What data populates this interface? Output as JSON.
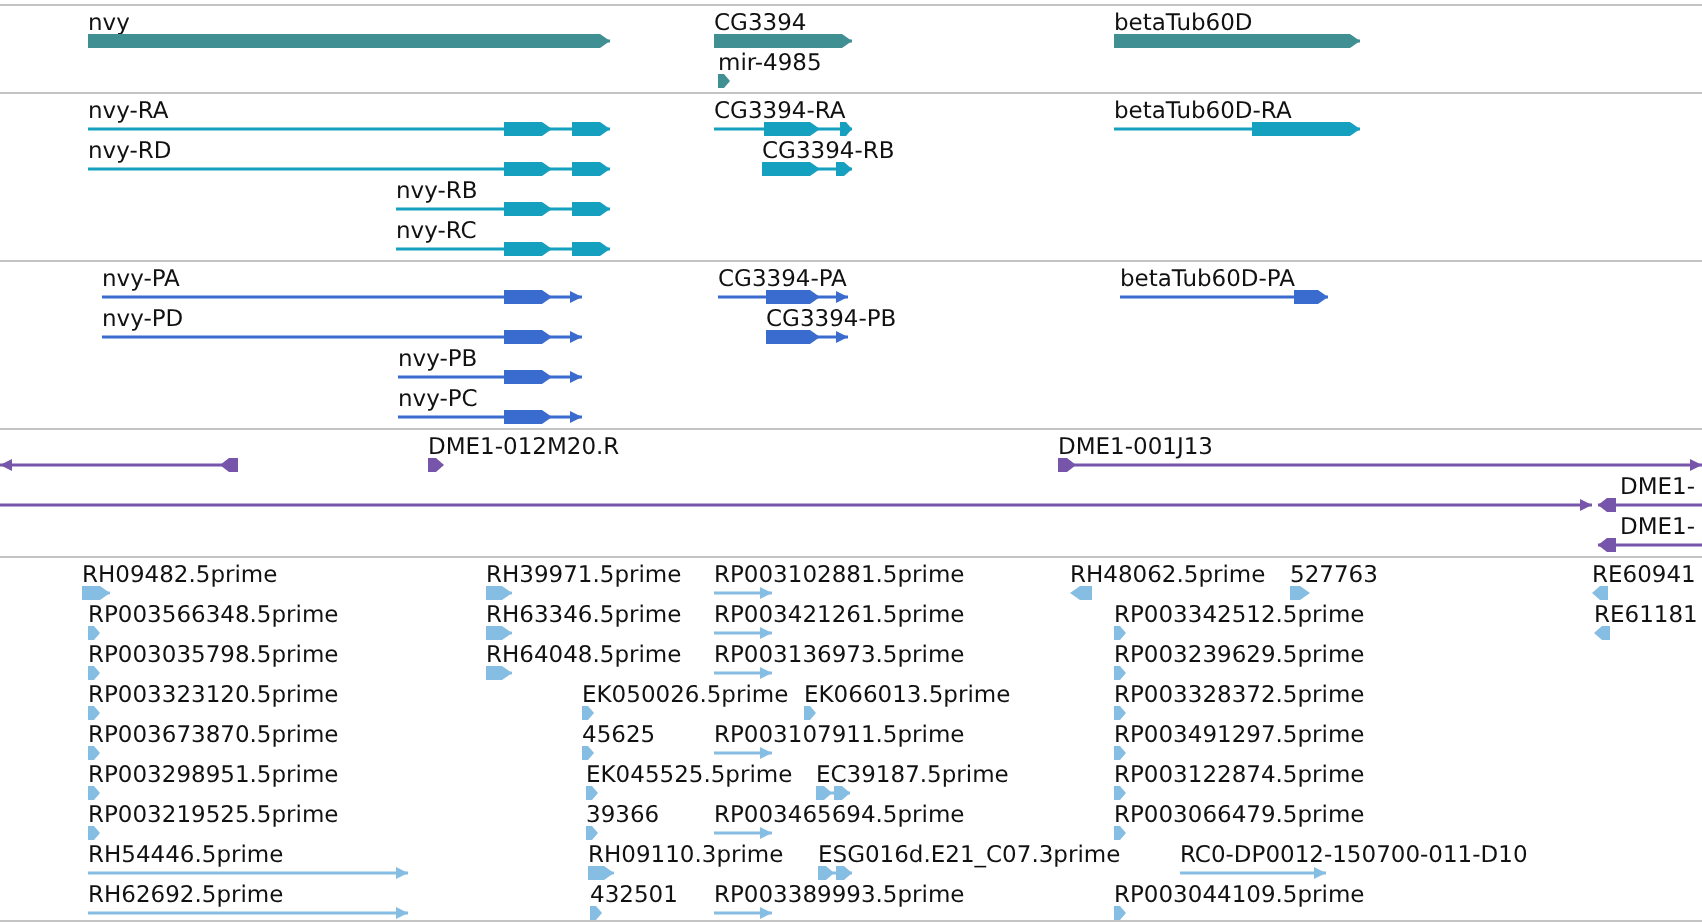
{
  "tracks": [
    {
      "kind": "gene",
      "features": [
        {
          "label": "nvy",
          "reverse": false
        },
        {
          "label": "CG3394",
          "reverse": false
        },
        {
          "label": "mir-4985",
          "reverse": false
        },
        {
          "label": "betaTub60D",
          "reverse": false
        }
      ]
    },
    {
      "kind": "transcript",
      "features": [
        {
          "label": "nvy-RA",
          "reverse": false
        },
        {
          "label": "nvy-RD",
          "reverse": false
        },
        {
          "label": "nvy-RB",
          "reverse": false
        },
        {
          "label": "nvy-RC",
          "reverse": false
        },
        {
          "label": "CG3394-RA",
          "reverse": false
        },
        {
          "label": "CG3394-RB",
          "reverse": false
        },
        {
          "label": "betaTub60D-RA",
          "reverse": false
        }
      ]
    },
    {
      "kind": "protein",
      "features": [
        {
          "label": "nvy-PA",
          "reverse": false
        },
        {
          "label": "nvy-PD",
          "reverse": false
        },
        {
          "label": "nvy-PB",
          "reverse": false
        },
        {
          "label": "nvy-PC",
          "reverse": false
        },
        {
          "label": "CG3394-PA",
          "reverse": false
        },
        {
          "label": "CG3394-PB",
          "reverse": false
        },
        {
          "label": "betaTub60D-PA",
          "reverse": false
        }
      ]
    },
    {
      "kind": "clone",
      "features": [
        {
          "reverse": true
        },
        {
          "label": "DME1-012M20.R",
          "reverse": false
        },
        {
          "label": "DME1-001J13",
          "reverse": false
        },
        {
          "reverse": false
        },
        {
          "label": "DME1-",
          "reverse": true
        },
        {
          "label": "DME1-",
          "reverse": true
        }
      ]
    },
    {
      "kind": "est",
      "features": [
        {
          "label": "RH09482.5prime",
          "reverse": false
        },
        {
          "label": "RP003566348.5prime",
          "reverse": false
        },
        {
          "label": "RP003035798.5prime",
          "reverse": false
        },
        {
          "label": "RP003323120.5prime",
          "reverse": false
        },
        {
          "label": "RP003673870.5prime",
          "reverse": false
        },
        {
          "label": "RP003298951.5prime",
          "reverse": false
        },
        {
          "label": "RP003219525.5prime",
          "reverse": false
        },
        {
          "label": "RH54446.5prime",
          "reverse": false
        },
        {
          "label": "RH62692.5prime",
          "reverse": false
        },
        {
          "label": "RH39971.5prime",
          "reverse": false
        },
        {
          "label": "RH63346.5prime",
          "reverse": false
        },
        {
          "label": "RH64048.5prime",
          "reverse": false
        },
        {
          "label": "EK050026.5prime",
          "reverse": false
        },
        {
          "label": "45625",
          "reverse": false
        },
        {
          "label": "EK045525.5prime",
          "reverse": false
        },
        {
          "label": "39366",
          "reverse": false
        },
        {
          "label": "RH09110.3prime",
          "reverse": false
        },
        {
          "label": "432501",
          "reverse": false
        },
        {
          "label": "RP003102881.5prime",
          "reverse": false
        },
        {
          "label": "RP003421261.5prime",
          "reverse": false
        },
        {
          "label": "RP003136973.5prime",
          "reverse": false
        },
        {
          "label": "EK066013.5prime",
          "reverse": false
        },
        {
          "label": "RP003107911.5prime",
          "reverse": false
        },
        {
          "label": "EC39187.5prime",
          "reverse": false
        },
        {
          "label": "RP003465694.5prime",
          "reverse": false
        },
        {
          "label": "ESG016d.E21_C07.3prime",
          "reverse": false
        },
        {
          "label": "RP003389993.5prime",
          "reverse": false
        },
        {
          "label": "RH48062.5prime",
          "reverse": true
        },
        {
          "label": "527763",
          "reverse": false
        },
        {
          "label": "RP003342512.5prime",
          "reverse": false
        },
        {
          "label": "RP003239629.5prime",
          "reverse": false
        },
        {
          "label": "RP003328372.5prime",
          "reverse": false
        },
        {
          "label": "RP003491297.5prime",
          "reverse": false
        },
        {
          "label": "RP003122874.5prime",
          "reverse": false
        },
        {
          "label": "RP003066479.5prime",
          "reverse": false
        },
        {
          "label": "RC0-DP0012-150700-011-D10",
          "reverse": false
        },
        {
          "label": "RP003044109.5prime",
          "reverse": false
        },
        {
          "label": "RE60941",
          "reverse": true
        },
        {
          "label": "RE61181",
          "reverse": true
        }
      ]
    }
  ]
}
